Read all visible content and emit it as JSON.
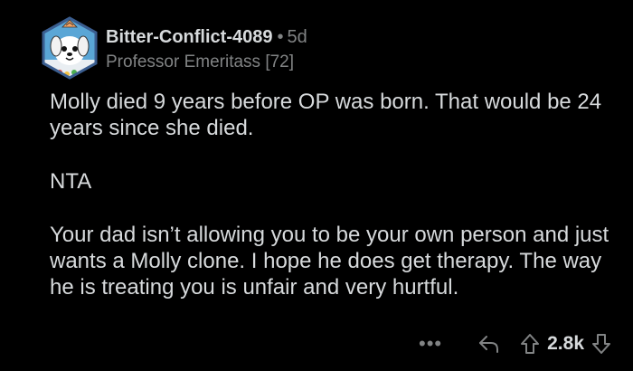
{
  "comment": {
    "username": "Bitter-Conflict-4089",
    "separator": "•",
    "age": "5d",
    "flair": "Professor Emeritass [72]",
    "paragraphs": [
      "Molly died 9 years before OP was born. That would be 24 years since she died.",
      "NTA",
      "Your dad isn’t allowing you to be your own person and just wants a Molly clone. I hope he does get therapy. The way he is treating you is unfair and very hurtful."
    ],
    "actions": {
      "more_icon": "more-icon",
      "reply_icon": "reply-icon",
      "upvote_icon": "upvote-icon",
      "score": "2.8k",
      "downvote_icon": "downvote-icon"
    }
  },
  "colors": {
    "background": "#000000",
    "text": "#d7dadc",
    "muted": "#818384",
    "avatar_ring": "#4a6fa5",
    "avatar_bg": "#5aa6d6"
  }
}
